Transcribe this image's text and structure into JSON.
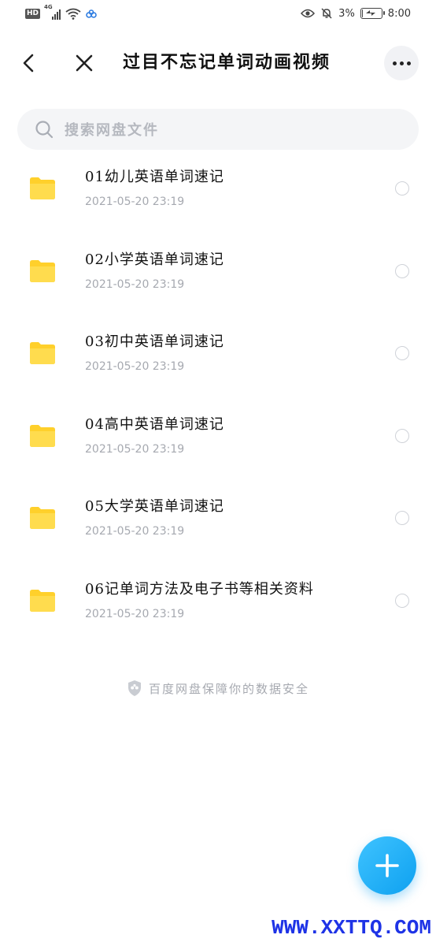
{
  "status_bar": {
    "hd": "HD",
    "network": "4G",
    "battery_text": "3%",
    "battery_level": 0.03,
    "time": "8:00"
  },
  "nav": {
    "title": "过目不忘记单词动画视频"
  },
  "search": {
    "placeholder": "搜索网盘文件"
  },
  "files": [
    {
      "name": "01幼儿英语单词速记",
      "date": "2021-05-20  23:19"
    },
    {
      "name": "02小学英语单词速记",
      "date": "2021-05-20  23:19"
    },
    {
      "name": "03初中英语单词速记",
      "date": "2021-05-20  23:19"
    },
    {
      "name": "04高中英语单词速记",
      "date": "2021-05-20  23:19"
    },
    {
      "name": "05大学英语单词速记",
      "date": "2021-05-20  23:19"
    },
    {
      "name": "06记单词方法及电子书等相关资料",
      "date": "2021-05-20  23:19"
    }
  ],
  "footer": {
    "security_note": "百度网盘保障你的数据安全"
  },
  "watermark": "WWW.XXTTQ.COM",
  "colors": {
    "folder": "#FFD02B",
    "accent": "#0EA1F0"
  }
}
